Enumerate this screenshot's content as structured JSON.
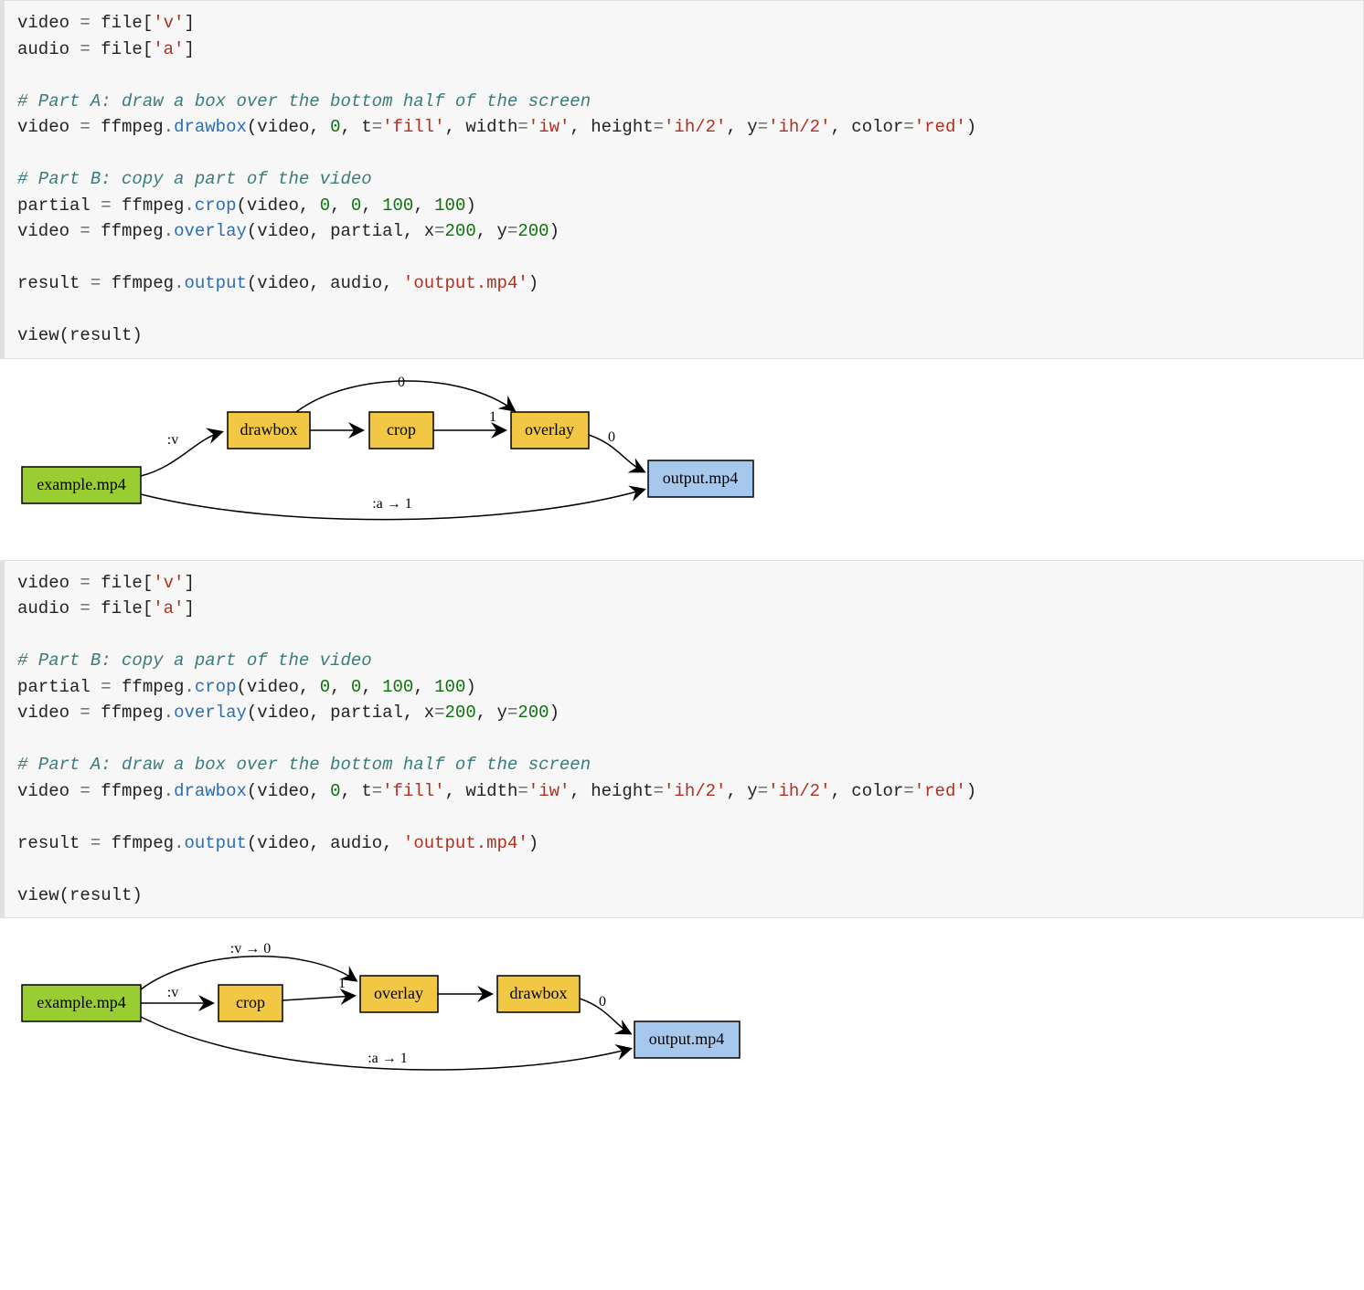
{
  "code1": {
    "l1a": "video ",
    "l1b": "=",
    "l1c": " file[",
    "l1d": "'v'",
    "l1e": "]",
    "l2a": "audio ",
    "l2b": "=",
    "l2c": " file[",
    "l2d": "'a'",
    "l2e": "]",
    "l3": "",
    "l4": "# Part A: draw a box over the bottom half of the screen",
    "l5a": "video ",
    "l5b": "=",
    "l5c": " ffmpeg",
    "l5d": ".",
    "l5e": "drawbox",
    "l5f": "(video, ",
    "l5g": "0",
    "l5h": ", t",
    "l5i": "=",
    "l5j": "'fill'",
    "l5k": ", width",
    "l5l": "=",
    "l5m": "'iw'",
    "l5n": ", height",
    "l5o": "=",
    "l5p": "'ih/2'",
    "l5q": ", y",
    "l5r": "=",
    "l5s": "'ih/2'",
    "l5t": ", color",
    "l5u": "=",
    "l5v": "'red'",
    "l5w": ")",
    "l6": "",
    "l7": "# Part B: copy a part of the video",
    "l8a": "partial ",
    "l8b": "=",
    "l8c": " ffmpeg",
    "l8d": ".",
    "l8e": "crop",
    "l8f": "(video, ",
    "l8g": "0",
    "l8h": ", ",
    "l8i": "0",
    "l8j": ", ",
    "l8k": "100",
    "l8l": ", ",
    "l8m": "100",
    "l8n": ")",
    "l9a": "video ",
    "l9b": "=",
    "l9c": " ffmpeg",
    "l9d": ".",
    "l9e": "overlay",
    "l9f": "(video, partial, x",
    "l9g": "=",
    "l9h": "200",
    "l9i": ", y",
    "l9j": "=",
    "l9k": "200",
    "l9l": ")",
    "l10": "",
    "l11a": "result ",
    "l11b": "=",
    "l11c": " ffmpeg",
    "l11d": ".",
    "l11e": "output",
    "l11f": "(video, audio, ",
    "l11g": "'output.mp4'",
    "l11h": ")",
    "l12": "",
    "l13": "view(result)"
  },
  "code2": {
    "l1a": "video ",
    "l1b": "=",
    "l1c": " file[",
    "l1d": "'v'",
    "l1e": "]",
    "l2a": "audio ",
    "l2b": "=",
    "l2c": " file[",
    "l2d": "'a'",
    "l2e": "]",
    "l3": "",
    "l4": "# Part B: copy a part of the video",
    "l5a": "partial ",
    "l5b": "=",
    "l5c": " ffmpeg",
    "l5d": ".",
    "l5e": "crop",
    "l5f": "(video, ",
    "l5g": "0",
    "l5h": ", ",
    "l5i": "0",
    "l5j": ", ",
    "l5k": "100",
    "l5l": ", ",
    "l5m": "100",
    "l5n": ")",
    "l6a": "video ",
    "l6b": "=",
    "l6c": " ffmpeg",
    "l6d": ".",
    "l6e": "overlay",
    "l6f": "(video, partial, x",
    "l6g": "=",
    "l6h": "200",
    "l6i": ", y",
    "l6j": "=",
    "l6k": "200",
    "l6l": ")",
    "l7": "",
    "l8": "# Part A: draw a box over the bottom half of the screen",
    "l9a": "video ",
    "l9b": "=",
    "l9c": " ffmpeg",
    "l9d": ".",
    "l9e": "drawbox",
    "l9f": "(video, ",
    "l9g": "0",
    "l9h": ", t",
    "l9i": "=",
    "l9j": "'fill'",
    "l9k": ", width",
    "l9l": "=",
    "l9m": "'iw'",
    "l9n": ", height",
    "l9o": "=",
    "l9p": "'ih/2'",
    "l9q": ", y",
    "l9r": "=",
    "l9s": "'ih/2'",
    "l9t": ", color",
    "l9u": "=",
    "l9v": "'red'",
    "l9w": ")",
    "l10": "",
    "l11a": "result ",
    "l11b": "=",
    "l11c": " ffmpeg",
    "l11d": ".",
    "l11e": "output",
    "l11f": "(video, audio, ",
    "l11g": "'output.mp4'",
    "l11h": ")",
    "l12": "",
    "l13": "view(result)"
  },
  "graph1": {
    "nodes": {
      "input": "example.mp4",
      "drawbox": "drawbox",
      "crop": "crop",
      "overlay": "overlay",
      "output": "output.mp4"
    },
    "edge_labels": {
      "v": ":v",
      "zero_top": "0",
      "one": "1",
      "zero_right": "0",
      "a_arrow_1": ":a   →   1"
    }
  },
  "graph2": {
    "nodes": {
      "input": "example.mp4",
      "crop": "crop",
      "overlay": "overlay",
      "drawbox": "drawbox",
      "output": "output.mp4"
    },
    "edge_labels": {
      "v_top": ":v   →   0",
      "v": ":v",
      "one": "1",
      "zero_right": "0",
      "a_arrow_1": ":a   →   1"
    }
  }
}
